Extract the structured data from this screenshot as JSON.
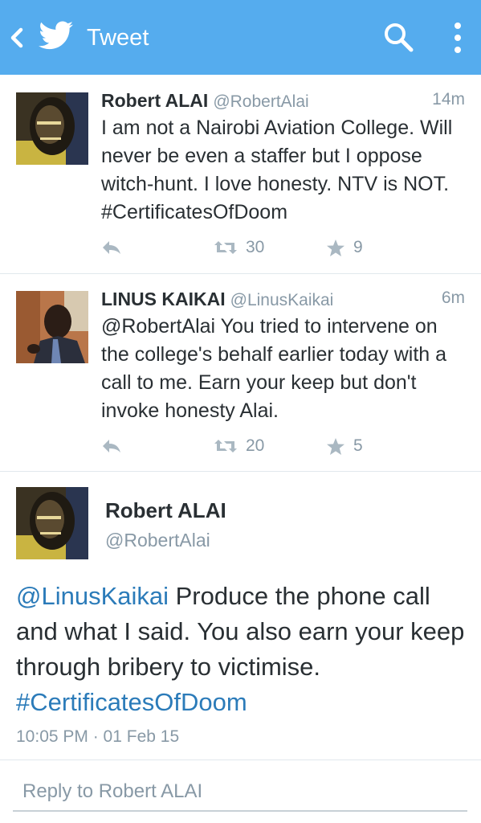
{
  "header": {
    "title": "Tweet"
  },
  "colors": {
    "brand": "#55acee",
    "link": "#2b7bb9",
    "muted": "#8899a6"
  },
  "tweets": [
    {
      "name": "Robert ALAI",
      "handle": "@RobertAlai",
      "time": "14m",
      "text": "I am not a Nairobi Aviation College. Will never be even a staffer but I oppose witch-hunt. I love honesty. NTV is NOT. #CertificatesOfDoom",
      "retweets": "30",
      "favorites": "9"
    },
    {
      "name": "LINUS KAIKAI",
      "handle": "@LinusKaikai",
      "time": "6m",
      "text": "@RobertAlai You tried to intervene on the college's behalf earlier today with a call to me.  Earn your keep but don't invoke honesty Alai.",
      "retweets": "20",
      "favorites": "5"
    }
  ],
  "main": {
    "name": "Robert ALAI",
    "handle": "@RobertAlai",
    "mention": "@LinusKaikai",
    "text": " Produce the phone call and what I said. You also earn your keep through bribery to victimise. ",
    "hashtag": "#CertificatesOfDoom",
    "timestamp": "10:05 PM · 01 Feb 15"
  },
  "reply": {
    "placeholder": "Reply to Robert ALAI"
  },
  "icons": [
    "back-icon",
    "twitter-bird-icon",
    "search-icon",
    "overflow-menu-icon",
    "reply-icon",
    "retweet-icon",
    "favorite-star-icon"
  ]
}
